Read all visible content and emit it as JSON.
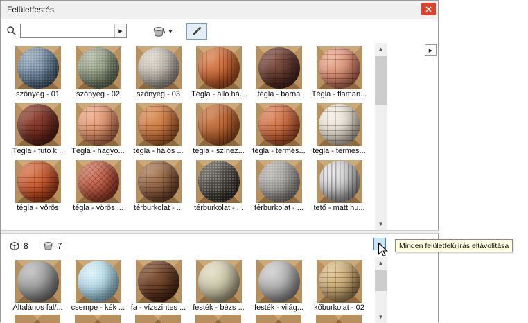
{
  "window": {
    "title": "Felületfestés"
  },
  "toolbar": {
    "search_value": "",
    "search_placeholder": "",
    "dropdown_arrow": "▶",
    "flyout_arrow": "▶"
  },
  "scrollbar": {
    "up": "▲",
    "down": "▼"
  },
  "divider": {
    "cube_count": "8",
    "bucket_count": "7",
    "flyout_arrow": "▶"
  },
  "tooltip": {
    "text": "Minden felületfelülírás eltávolítása"
  },
  "colors": {
    "backdrop_top": "#cfa878",
    "backdrop_side": "#b8905e",
    "backdrop_bottom": "#8f6a3e",
    "close_button": "#e0412e",
    "highlight_border": "#3c7fb1",
    "tooltip_bg": "#fffee1"
  },
  "materials_top": [
    {
      "label": "szőnyeg - 01",
      "c1": "#8fa3b5",
      "c2": "#4e6a85",
      "c3": "#233240",
      "pattern": "speck"
    },
    {
      "label": "szőnyeg - 02",
      "c1": "#a9b29a",
      "c2": "#6f7b61",
      "c3": "#3a4233",
      "pattern": "speck"
    },
    {
      "label": "szőnyeg - 03",
      "c1": "#d9d2c6",
      "c2": "#a8a095",
      "c3": "#5f584e",
      "pattern": "speck"
    },
    {
      "label": "Tégla - álló há...",
      "c1": "#e08a5a",
      "c2": "#c05c2c",
      "c3": "#7a3514",
      "pattern": "v"
    },
    {
      "label": "tégla - barna",
      "c1": "#8a5a4a",
      "c2": "#5c332a",
      "c3": "#2e1712",
      "pattern": "grid"
    },
    {
      "label": "Tégla - flaman...",
      "c1": "#eeb49a",
      "c2": "#d4846a",
      "c3": "#8a4a38",
      "pattern": "grid"
    },
    {
      "label": "Tégla - futó k...",
      "c1": "#9a4a3a",
      "c2": "#6e2a20",
      "c3": "#3a130e",
      "pattern": "grid"
    },
    {
      "label": "Tégla - hagyo...",
      "c1": "#f0b090",
      "c2": "#d98a64",
      "c3": "#8f4e34",
      "pattern": "grid"
    },
    {
      "label": "tégla - hálós ...",
      "c1": "#e0945c",
      "c2": "#c2703a",
      "c3": "#7c411c",
      "pattern": "grid"
    },
    {
      "label": "tégla - színez...",
      "c1": "#d08050",
      "c2": "#b05c2a",
      "c3": "#6e3514",
      "pattern": "v"
    },
    {
      "label": "tégla - termés...",
      "c1": "#e08a60",
      "c2": "#c46238",
      "c3": "#7c371a",
      "pattern": "grid"
    },
    {
      "label": "tégla - termés...",
      "c1": "#f5f1e8",
      "c2": "#ddd6c8",
      "c3": "#8f897c",
      "pattern": "grid"
    },
    {
      "label": "tégla - vörös",
      "c1": "#da7a52",
      "c2": "#c04f26",
      "c3": "#732c12",
      "pattern": "grid"
    },
    {
      "label": "tégla - vörös ...",
      "c1": "#d4806a",
      "c2": "#b8503a",
      "c3": "#6e2a1c",
      "pattern": "herr"
    },
    {
      "label": "térburkolat - ...",
      "c1": "#b08662",
      "c2": "#86573a",
      "c3": "#4a2d1c",
      "pattern": "grid"
    },
    {
      "label": "térburkolat - ...",
      "c1": "#5f5b55",
      "c2": "#37342f",
      "c3": "#141311",
      "pattern": "speck"
    },
    {
      "label": "térburkolat - ...",
      "c1": "#b5b3af",
      "c2": "#8c8a86",
      "c3": "#4e4c49",
      "pattern": "speck"
    },
    {
      "label": "tető - matt hu...",
      "c1": "#ececec",
      "c2": "#bdbdbd",
      "c3": "#6e6e6e",
      "pattern": "ribs"
    }
  ],
  "materials_bottom": [
    {
      "label": "Általános fal/...",
      "c1": "#c2c2c2",
      "c2": "#8f8f8f",
      "c3": "#4c4c4c",
      "pattern": "none"
    },
    {
      "label": "csempe - kék ...",
      "c1": "#d8eff6",
      "c2": "#9cc9dc",
      "c3": "#4e7d92",
      "pattern": "speck"
    },
    {
      "label": "fa - vízszintes ...",
      "c1": "#8a5a3c",
      "c2": "#5f3620",
      "c3": "#2c160c",
      "pattern": "h"
    },
    {
      "label": "festék - bézs ...",
      "c1": "#e4dec6",
      "c2": "#c2bb9e",
      "c3": "#6e684f",
      "pattern": "none"
    },
    {
      "label": "festék - világ...",
      "c1": "#d2d2d2",
      "c2": "#a5a5a5",
      "c3": "#5a5a5a",
      "pattern": "none"
    },
    {
      "label": "kőburkolat - 02",
      "c1": "#e2c796",
      "c2": "#c0a26e",
      "c3": "#6e5534",
      "pattern": "grid"
    }
  ]
}
